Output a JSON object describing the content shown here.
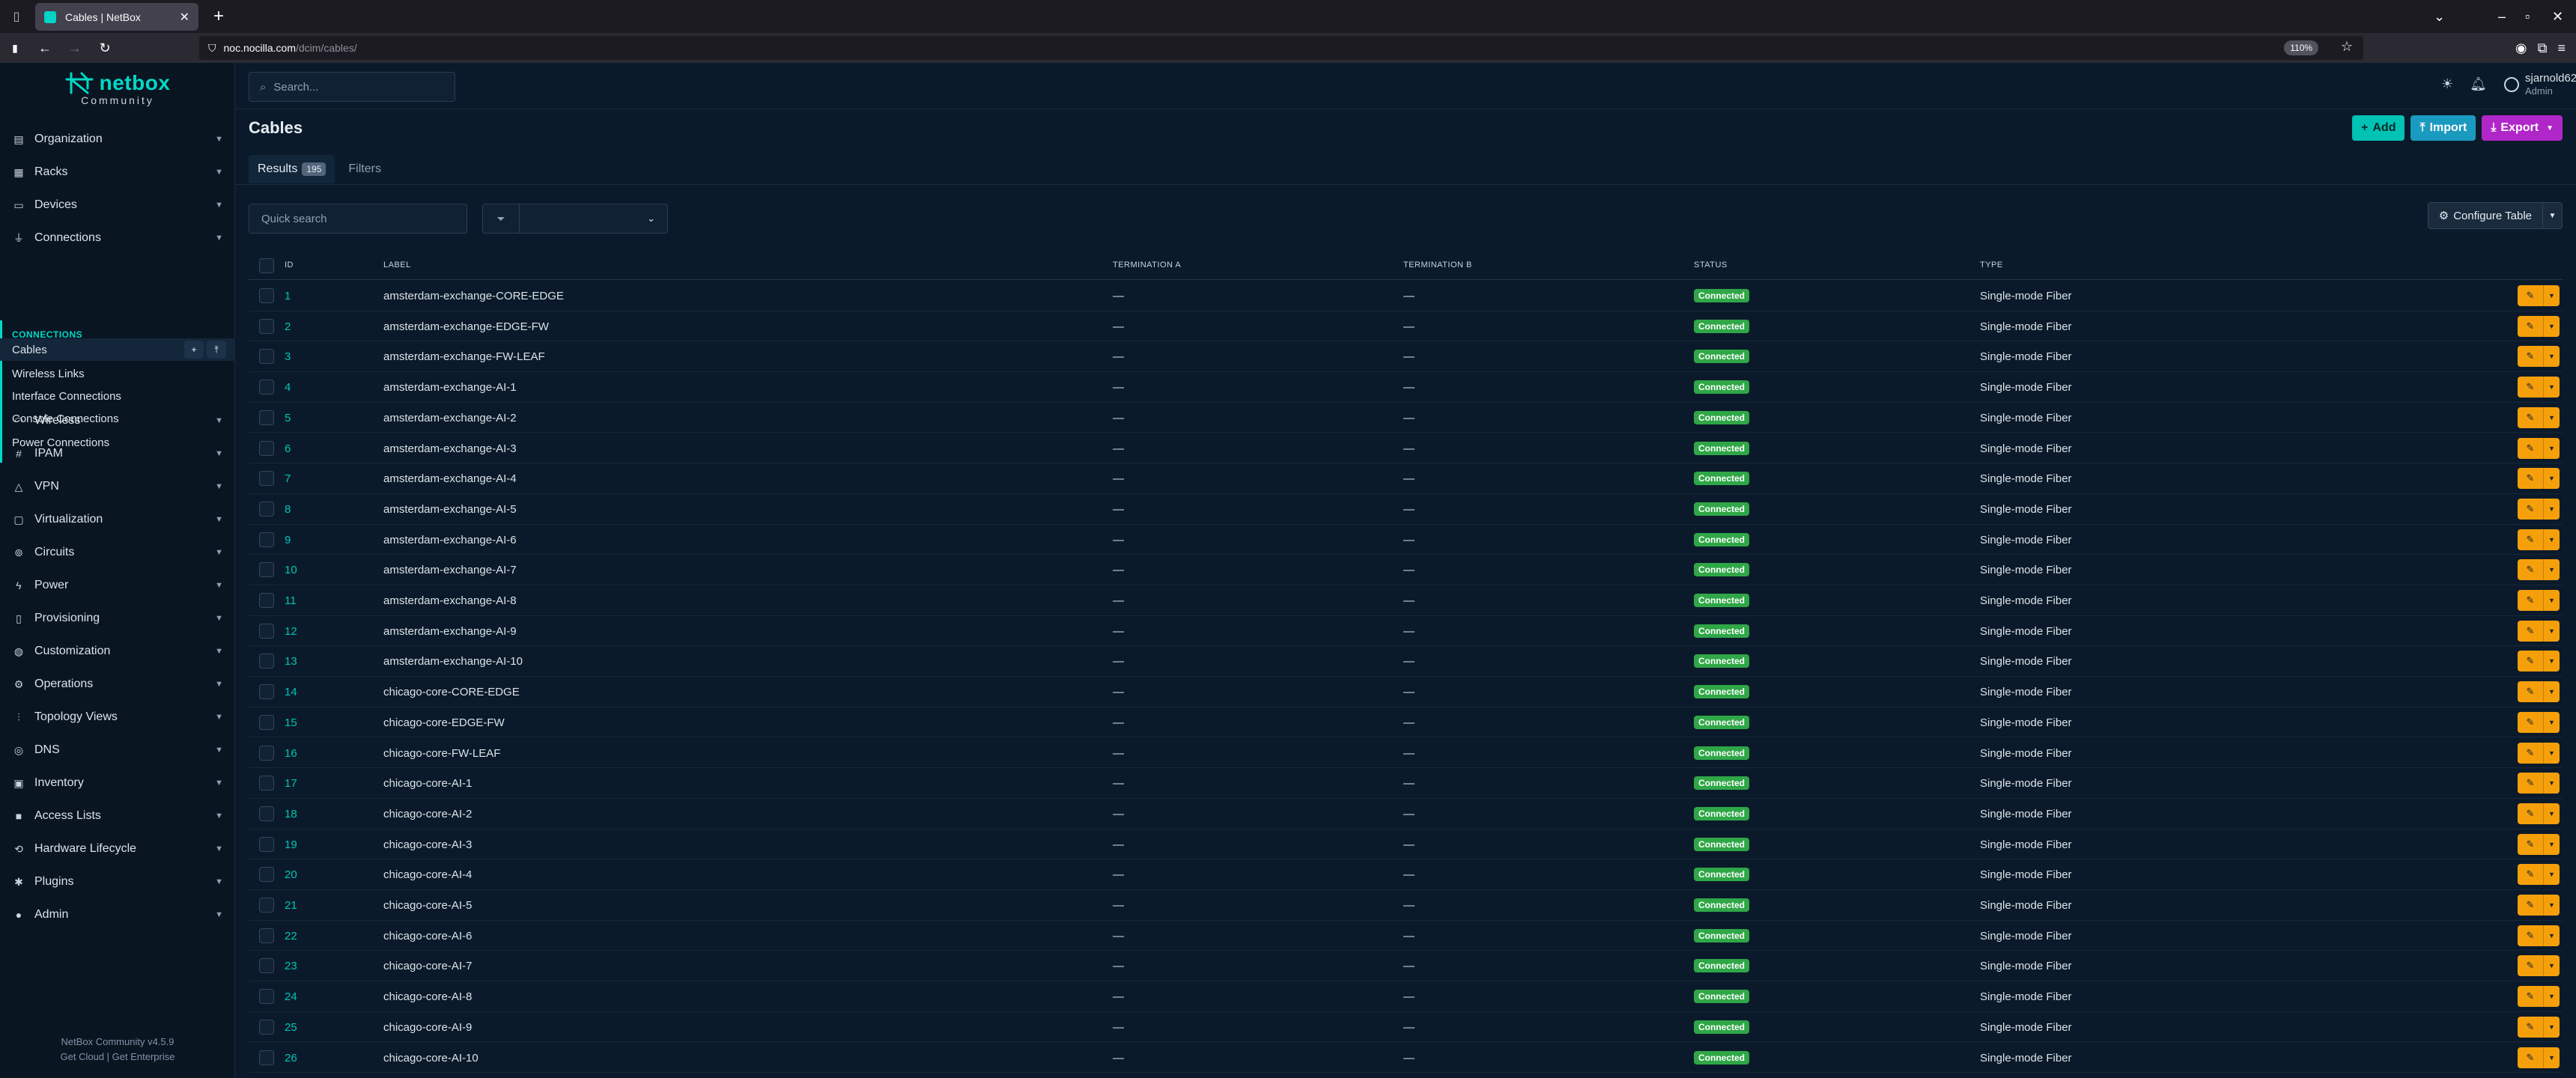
{
  "browser": {
    "tab_title": "Cables | NetBox",
    "url_host": "noc.nocilla.com",
    "url_path": "/dcim/cables/",
    "zoom": "110%"
  },
  "brand": {
    "name": "netbox",
    "sub": "Community"
  },
  "sidebar": {
    "groups": [
      {
        "label": "Organization",
        "icon": "building-icon"
      },
      {
        "label": "Racks",
        "icon": "rack-icon"
      },
      {
        "label": "Devices",
        "icon": "server-icon"
      },
      {
        "label": "Connections",
        "icon": "plug-icon"
      },
      {
        "label": "Wireless",
        "icon": "wifi-icon"
      },
      {
        "label": "IPAM",
        "icon": "counter-icon"
      },
      {
        "label": "VPN",
        "icon": "tunnel-icon"
      },
      {
        "label": "Virtualization",
        "icon": "monitor-icon"
      },
      {
        "label": "Circuits",
        "icon": "circuit-icon"
      },
      {
        "label": "Power",
        "icon": "flash-icon"
      },
      {
        "label": "Provisioning",
        "icon": "file-icon"
      },
      {
        "label": "Customization",
        "icon": "palette-icon"
      },
      {
        "label": "Operations",
        "icon": "cog-icon"
      },
      {
        "label": "Topology Views",
        "icon": "graph-icon"
      },
      {
        "label": "DNS",
        "icon": "globe-icon"
      },
      {
        "label": "Inventory",
        "icon": "box-icon"
      },
      {
        "label": "Access Lists",
        "icon": "lock-icon"
      },
      {
        "label": "Hardware Lifecycle",
        "icon": "cycle-icon"
      },
      {
        "label": "Plugins",
        "icon": "puzzle-icon"
      },
      {
        "label": "Admin",
        "icon": "admin-icon"
      }
    ],
    "submenu_heading": "CONNECTIONS",
    "submenu": [
      "Cables",
      "Wireless Links",
      "Interface Connections",
      "Console Connections",
      "Power Connections"
    ],
    "footer_version": "NetBox Community v4.5.9",
    "footer_links": "Get Cloud | Get Enterprise"
  },
  "topbar": {
    "search_placeholder": "Search...",
    "user_name": "sjarnold62",
    "user_role": "Admin"
  },
  "page": {
    "title": "Cables",
    "add_label": "Add",
    "import_label": "Import",
    "export_label": "Export",
    "tab_results": "Results",
    "results_count": "195",
    "tab_filters": "Filters",
    "quick_search_placeholder": "Quick search",
    "configure_label": "Configure Table"
  },
  "table": {
    "headers": [
      "ID",
      "LABEL",
      "TERMINATION A",
      "TERMINATION B",
      "STATUS",
      "TYPE"
    ],
    "status_color": "#2fa747",
    "rows": [
      {
        "id": "1",
        "label": "amsterdam-exchange-CORE-EDGE"
      },
      {
        "id": "2",
        "label": "amsterdam-exchange-EDGE-FW"
      },
      {
        "id": "3",
        "label": "amsterdam-exchange-FW-LEAF"
      },
      {
        "id": "4",
        "label": "amsterdam-exchange-AI-1"
      },
      {
        "id": "5",
        "label": "amsterdam-exchange-AI-2"
      },
      {
        "id": "6",
        "label": "amsterdam-exchange-AI-3"
      },
      {
        "id": "7",
        "label": "amsterdam-exchange-AI-4"
      },
      {
        "id": "8",
        "label": "amsterdam-exchange-AI-5"
      },
      {
        "id": "9",
        "label": "amsterdam-exchange-AI-6"
      },
      {
        "id": "10",
        "label": "amsterdam-exchange-AI-7"
      },
      {
        "id": "11",
        "label": "amsterdam-exchange-AI-8"
      },
      {
        "id": "12",
        "label": "amsterdam-exchange-AI-9"
      },
      {
        "id": "13",
        "label": "amsterdam-exchange-AI-10"
      },
      {
        "id": "14",
        "label": "chicago-core-CORE-EDGE"
      },
      {
        "id": "15",
        "label": "chicago-core-EDGE-FW"
      },
      {
        "id": "16",
        "label": "chicago-core-FW-LEAF"
      },
      {
        "id": "17",
        "label": "chicago-core-AI-1"
      },
      {
        "id": "18",
        "label": "chicago-core-AI-2"
      },
      {
        "id": "19",
        "label": "chicago-core-AI-3"
      },
      {
        "id": "20",
        "label": "chicago-core-AI-4"
      },
      {
        "id": "21",
        "label": "chicago-core-AI-5"
      },
      {
        "id": "22",
        "label": "chicago-core-AI-6"
      },
      {
        "id": "23",
        "label": "chicago-core-AI-7"
      },
      {
        "id": "24",
        "label": "chicago-core-AI-8"
      },
      {
        "id": "25",
        "label": "chicago-core-AI-9"
      },
      {
        "id": "26",
        "label": "chicago-core-AI-10"
      }
    ],
    "termination_placeholder": "—",
    "status_value": "Connected",
    "type_value": "Single-mode Fiber"
  }
}
